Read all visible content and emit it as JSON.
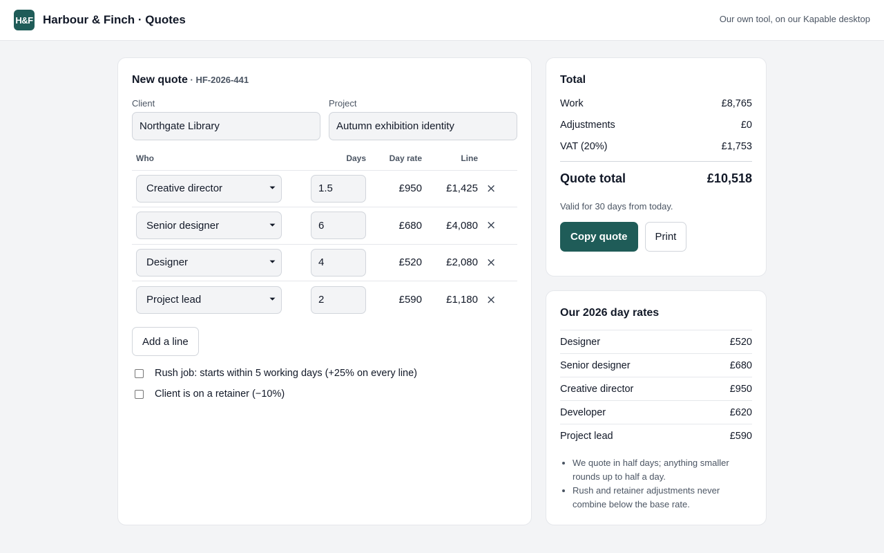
{
  "header": {
    "logo_text": "H&F",
    "title": "Harbour & Finch · Quotes",
    "note": "Our own tool, on our Kapable desktop"
  },
  "quote": {
    "heading": "New quote",
    "separator": " · ",
    "id": "HF-2026-441",
    "client_label": "Client",
    "client_value": "Northgate Library",
    "project_label": "Project",
    "project_value": "Autumn exhibition identity",
    "columns": {
      "who": "Who",
      "days": "Days",
      "rate": "Day rate",
      "line": "Line"
    },
    "lines": [
      {
        "role": "Creative director",
        "days": "1.5",
        "rate": "£950",
        "total": "£1,425"
      },
      {
        "role": "Senior designer",
        "days": "6",
        "rate": "£680",
        "total": "£4,080"
      },
      {
        "role": "Designer",
        "days": "4",
        "rate": "£520",
        "total": "£2,080"
      },
      {
        "role": "Project lead",
        "days": "2",
        "rate": "£590",
        "total": "£1,180"
      }
    ],
    "remove_glyph": "×",
    "add_line_label": "Add a line",
    "rush_label": "Rush job: starts within 5 working days (+25% on every line)",
    "rush_checked": false,
    "retainer_label": "Client is on a retainer (−10%)",
    "retainer_checked": false
  },
  "total": {
    "title": "Total",
    "work_label": "Work",
    "work_value": "£8,765",
    "adj_label": "Adjustments",
    "adj_value": "£0",
    "vat_label": "VAT (20%)",
    "vat_value": "£1,753",
    "grand_label": "Quote total",
    "grand_value": "£10,518",
    "valid_note": "Valid for 30 days from today.",
    "copy_label": "Copy quote",
    "print_label": "Print"
  },
  "rates": {
    "title": "Our 2026 day rates",
    "items": [
      {
        "role": "Designer",
        "rate": "£520"
      },
      {
        "role": "Senior designer",
        "rate": "£680"
      },
      {
        "role": "Creative director",
        "rate": "£950"
      },
      {
        "role": "Developer",
        "rate": "£620"
      },
      {
        "role": "Project lead",
        "rate": "£590"
      }
    ],
    "notes": [
      "We quote in half days; anything smaller rounds up to half a day.",
      "Rush and retainer adjustments never combine below the base rate."
    ]
  },
  "colors": {
    "brand": "#1f5c58",
    "background": "#f3f4f6"
  }
}
